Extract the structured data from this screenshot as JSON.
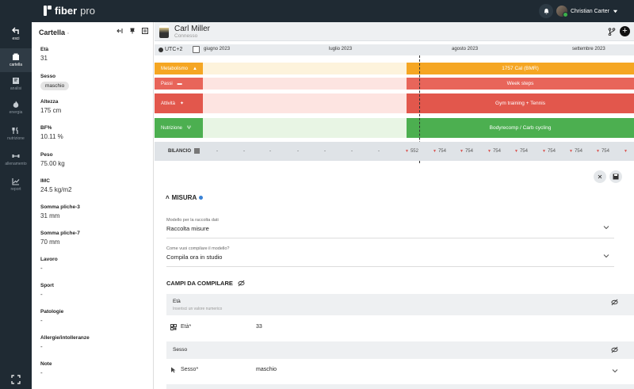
{
  "app": {
    "brand": "fiber",
    "brand_suffix": "pro"
  },
  "topbar": {
    "user_name": "Christian Carter"
  },
  "nav": [
    {
      "label": "esci",
      "icon": "back-arrow-icon"
    },
    {
      "label": "cartella",
      "icon": "folder-icon"
    },
    {
      "label": "analisi",
      "icon": "document-icon"
    },
    {
      "label": "energia",
      "icon": "flame-icon"
    },
    {
      "label": "nutrizione",
      "icon": "cutlery-icon"
    },
    {
      "label": "allenamento",
      "icon": "dumbbell-icon"
    },
    {
      "label": "report",
      "icon": "chart-icon"
    }
  ],
  "sidebar": {
    "title": "Cartella",
    "fields": [
      {
        "label": "Età",
        "value": "31"
      },
      {
        "label": "Sesso",
        "chip": "maschio"
      },
      {
        "label": "Altezza",
        "value": "175 cm"
      },
      {
        "label": "BF%",
        "value": "10.11 %"
      },
      {
        "label": "Peso",
        "value": "75.00 kg"
      },
      {
        "label": "IMC",
        "value": "24.5 kg/m2"
      },
      {
        "label": "Somma pliche-3",
        "value": "31 mm"
      },
      {
        "label": "Somma pliche-7",
        "value": "70 mm"
      },
      {
        "label": "Lavoro",
        "value": "-"
      },
      {
        "label": "Sport",
        "value": "-"
      },
      {
        "label": "Patologie",
        "value": "-"
      },
      {
        "label": "Allergie/intolleranze",
        "value": "-"
      },
      {
        "label": "Note",
        "value": "-"
      }
    ]
  },
  "patient": {
    "name": "Carl Miller",
    "status": "Connesso"
  },
  "timeline": {
    "timezone": "UTC+2",
    "months": [
      "giugno 2023",
      "luglio 2023",
      "agosto 2023",
      "settembre 2023"
    ],
    "rows": [
      {
        "label": "Metabolismo",
        "text": "1757 Cal (BMR)",
        "color": "#f5a623",
        "faint": "#fdf3dc"
      },
      {
        "label": "Passi",
        "text": "Week steps",
        "color": "#e8655a",
        "faint": "#fde4e1"
      },
      {
        "label": "Attività",
        "text": "Gym training + Tennis",
        "color": "#e2574c",
        "faint": "#fde4e1"
      },
      {
        "label": "Nutrizione",
        "text": "Bodyrecomp / Carb cycling",
        "color": "#4caf50",
        "faint": "#e8f5e4"
      }
    ],
    "bilancio": {
      "label": "BILANCIO",
      "values": [
        "-",
        "-",
        "-",
        "-",
        "-",
        "-",
        "-",
        "552",
        "754",
        "754",
        "754",
        "754",
        "754",
        "754",
        "754"
      ]
    }
  },
  "form": {
    "section_title": "MISURA",
    "model_select": {
      "label": "Modello per la raccolta dati",
      "value": "Raccolta misure"
    },
    "mode_select": {
      "label": "Come vuoi compilare il modello?",
      "value": "Compila ora in studio"
    },
    "fields_title": "CAMPI DA COMPILARE",
    "sections": [
      {
        "title": "Età",
        "subtitle": "Inserisci un valore numerico",
        "field_label": "Età*",
        "field_value": "33"
      },
      {
        "title": "Sesso",
        "field_label": "Sesso*",
        "field_value": "maschio"
      }
    ]
  }
}
